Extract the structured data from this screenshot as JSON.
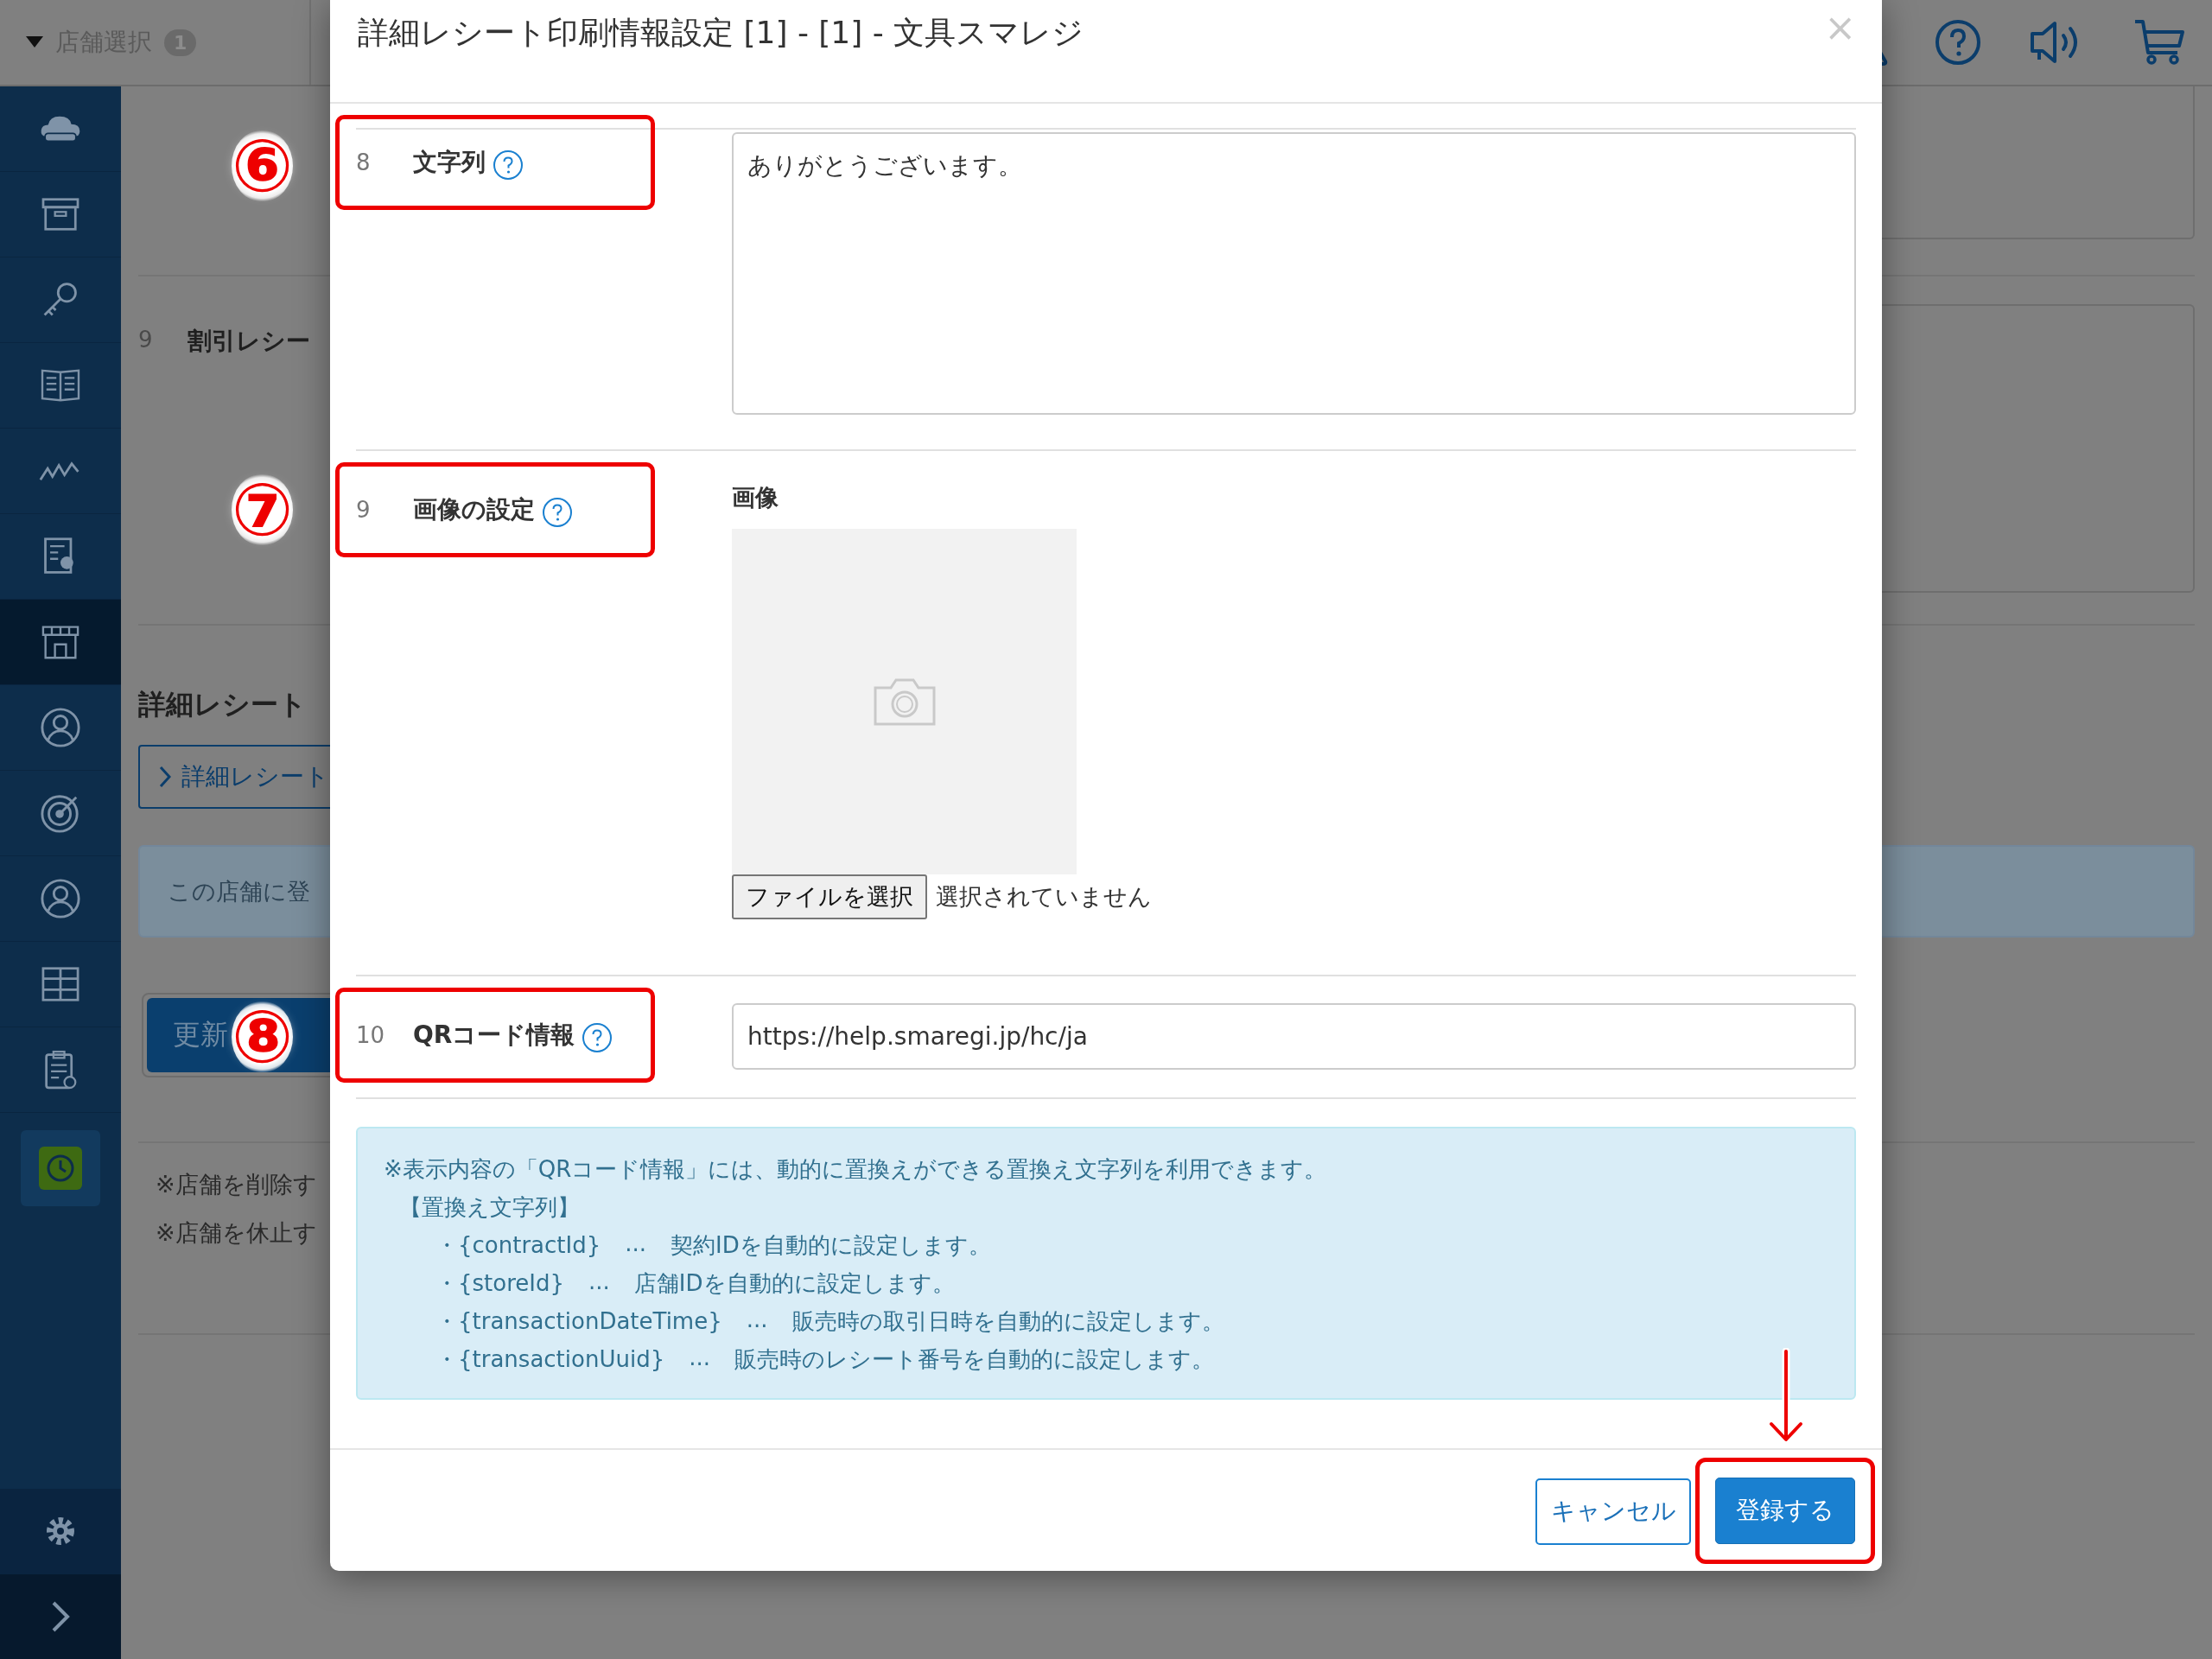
{
  "top_bar": {
    "store_select": {
      "label": "店舗選択",
      "badge": "1"
    }
  },
  "sidebar": {
    "items": [
      {
        "selected": false
      },
      {
        "selected": false
      },
      {
        "selected": false
      },
      {
        "selected": false
      },
      {
        "selected": false
      },
      {
        "selected": false
      },
      {
        "selected": true
      },
      {
        "selected": false
      },
      {
        "selected": false
      },
      {
        "selected": false
      },
      {
        "selected": false
      },
      {
        "selected": false
      },
      {
        "selected": false
      }
    ]
  },
  "background": {
    "row": {
      "number": "9",
      "label": "割引レシー"
    },
    "section_title": "詳細レシート",
    "link_button": "詳細レシート",
    "notice": "この店舗に登",
    "update_button": "更新",
    "notes": [
      "※店舗を削除す",
      "※店舗を休止す"
    ]
  },
  "modal": {
    "title": "詳細レシート印刷情報設定 [1] - [1] - 文具スマレジ",
    "close": "×",
    "fields": [
      {
        "number": "8",
        "label": "文字列",
        "kind": "textarea",
        "value": "ありがとうございます。"
      },
      {
        "number": "9",
        "label": "画像の設定",
        "kind": "image",
        "image_label": "画像",
        "file_button": "ファイルを選択",
        "file_status": "選択されていません"
      },
      {
        "number": "10",
        "label": "QRコード情報",
        "kind": "input",
        "value": "https://help.smaregi.jp/hc/ja"
      }
    ],
    "info": {
      "intro": "※表示内容の「QRコード情報」には、動的に置換えができる置換え文字列を利用できます。",
      "heading": "【置換え文字列】",
      "items": [
        {
          "token": "・{contractId}",
          "dots": "...",
          "description": "契約IDを自動的に設定します。"
        },
        {
          "token": "・{storeId}",
          "dots": "...",
          "description": "店舗IDを自動的に設定します。"
        },
        {
          "token": "・{transactionDateTime}",
          "dots": "...",
          "description": "販売時の取引日時を自動的に設定します。"
        },
        {
          "token": "・{transactionUuid}",
          "dots": "...",
          "description": "販売時のレシート番号を自動的に設定します。"
        }
      ]
    },
    "buttons": [
      {
        "label": "キャンセル",
        "kind": "secondary"
      },
      {
        "label": "登録する",
        "kind": "primary"
      }
    ]
  },
  "annotations": {
    "markers": [
      "⑥",
      "⑦",
      "⑧"
    ]
  }
}
